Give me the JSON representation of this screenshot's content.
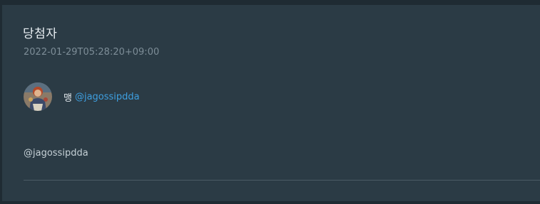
{
  "post": {
    "title": "당첨자",
    "timestamp": "2022-01-29T05:28:20+09:00",
    "author": {
      "name": "맹",
      "handle": "@jagossipdda",
      "avatar_icon": "profile-avatar"
    },
    "content": "@jagossipdda"
  },
  "colors": {
    "background": "#1f2b33",
    "card": "#2b3b45",
    "link": "#3e9fe0",
    "muted": "#7d8d97"
  }
}
